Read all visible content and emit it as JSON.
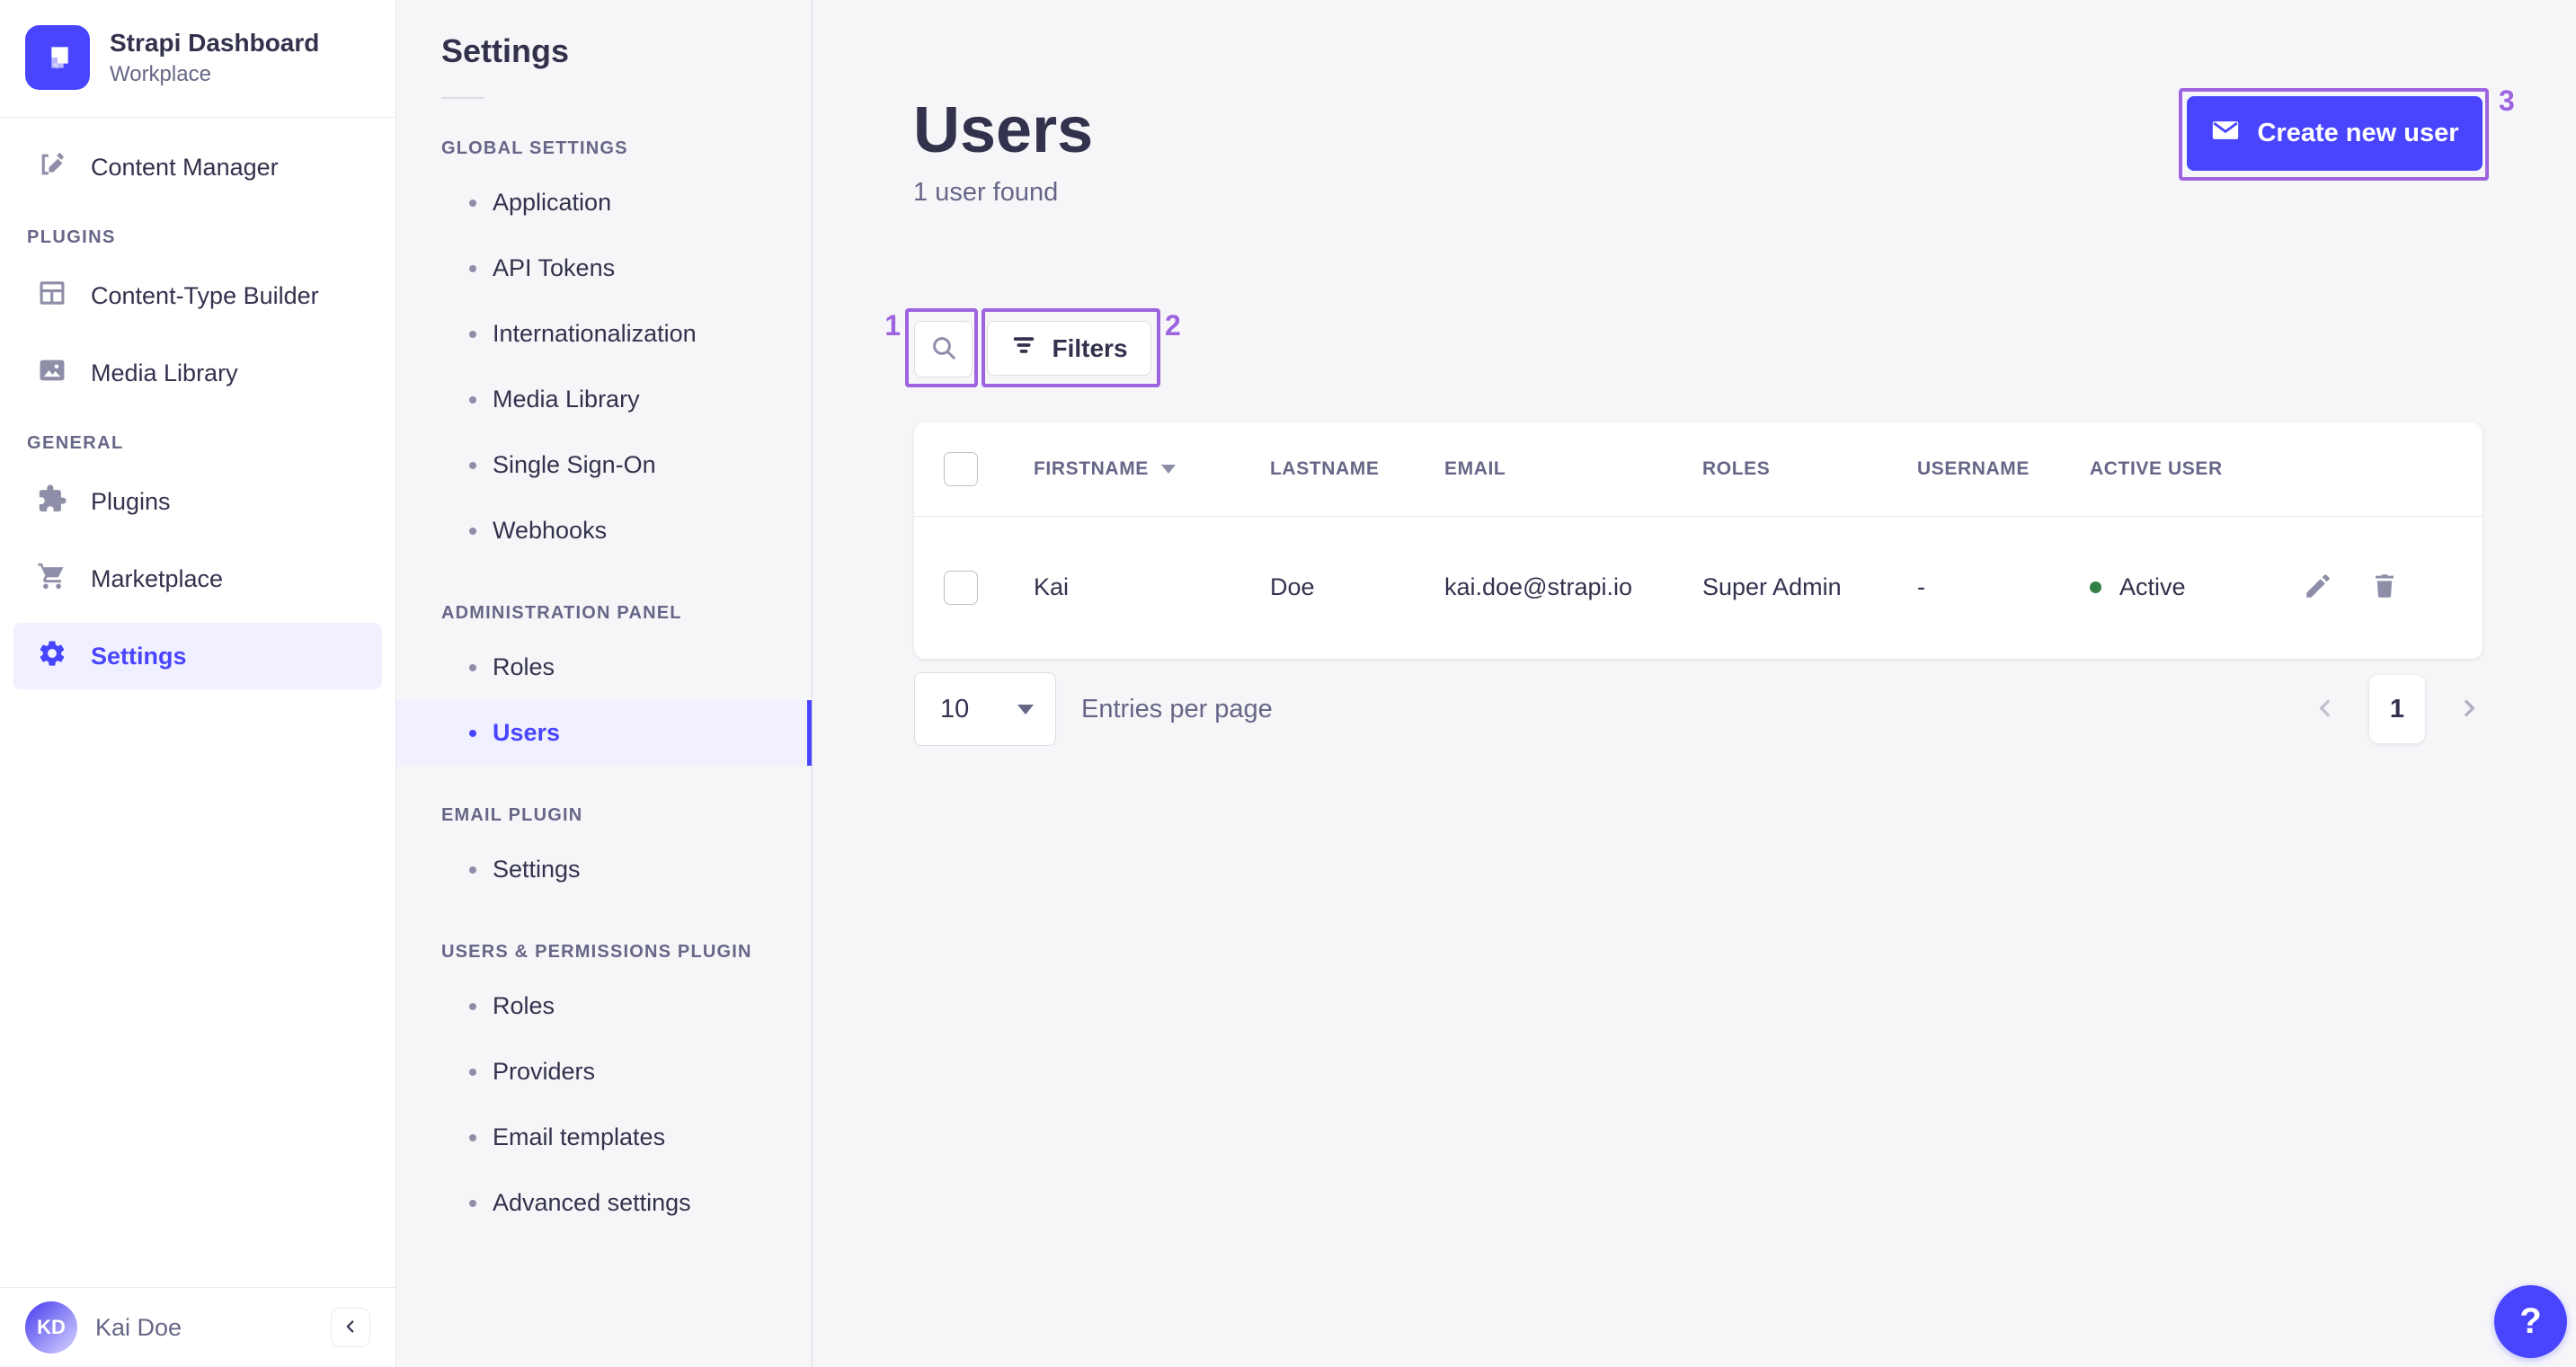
{
  "brand": {
    "title": "Strapi Dashboard",
    "subtitle": "Workplace"
  },
  "nav": {
    "content_manager": "Content Manager",
    "plugins_section": "PLUGINS",
    "content_type_builder": "Content-Type Builder",
    "media_library": "Media Library",
    "general_section": "GENERAL",
    "plugins": "Plugins",
    "marketplace": "Marketplace",
    "settings": "Settings"
  },
  "user": {
    "initials": "KD",
    "name": "Kai Doe"
  },
  "subnav": {
    "title": "Settings",
    "groups": [
      {
        "label": "GLOBAL SETTINGS",
        "items": [
          "Application",
          "API Tokens",
          "Internationalization",
          "Media Library",
          "Single Sign-On",
          "Webhooks"
        ]
      },
      {
        "label": "ADMINISTRATION PANEL",
        "items": [
          "Roles",
          "Users"
        ]
      },
      {
        "label": "EMAIL PLUGIN",
        "items": [
          "Settings"
        ]
      },
      {
        "label": "USERS & PERMISSIONS PLUGIN",
        "items": [
          "Roles",
          "Providers",
          "Email templates",
          "Advanced settings"
        ]
      }
    ],
    "active_item": "Users"
  },
  "page": {
    "title": "Users",
    "subtitle": "1 user found",
    "create_button": "Create new user",
    "filters_button": "Filters"
  },
  "table": {
    "headers": {
      "firstname": "FIRSTNAME",
      "lastname": "LASTNAME",
      "email": "EMAIL",
      "roles": "ROLES",
      "username": "USERNAME",
      "active": "ACTIVE USER"
    },
    "row": {
      "firstname": "Kai",
      "lastname": "Doe",
      "email": "kai.doe@strapi.io",
      "roles": "Super Admin",
      "username": "-",
      "active_label": "Active"
    }
  },
  "pagination": {
    "page_size": "10",
    "entries_label": "Entries per page",
    "page": "1"
  },
  "annotations": {
    "search": "1",
    "filters": "2",
    "create": "3",
    "color": "#9e64e0"
  },
  "help_label": "?",
  "colors": {
    "primary": "#4945ff",
    "success": "#328048",
    "background": "#f6f6f9"
  }
}
